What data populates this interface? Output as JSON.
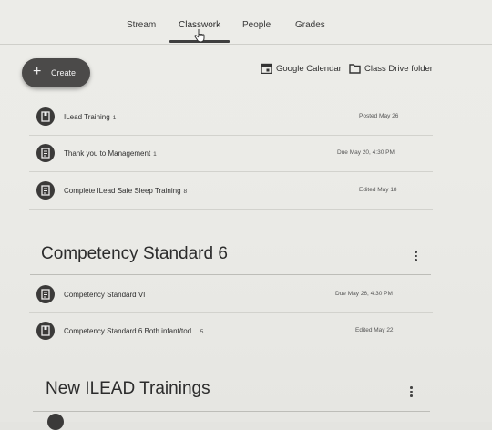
{
  "tabs": [
    {
      "label": "Stream"
    },
    {
      "label": "Classwork"
    },
    {
      "label": "People"
    },
    {
      "label": "Grades"
    }
  ],
  "toolbar": {
    "create_label": "Create",
    "calendar_label": "Google Calendar",
    "drive_label": "Class Drive folder"
  },
  "items": [
    {
      "title": "ILead Training",
      "count": "1",
      "meta": "Posted May 26",
      "icon": "material-icon"
    },
    {
      "title": "Thank you to Management",
      "count": "1",
      "meta": "Due May 20, 4:30 PM",
      "icon": "assignment-icon"
    },
    {
      "title": "Complete ILead Safe Sleep Training",
      "count": "8",
      "meta": "Edited May 18",
      "icon": "assignment-icon"
    }
  ],
  "sections": [
    {
      "title": "Competency Standard 6",
      "items": [
        {
          "title": "Competency Standard VI",
          "count": "",
          "meta": "Due May 26, 4:30 PM",
          "icon": "assignment-icon"
        },
        {
          "title": "Competency Standard 6 Both infant/tod...",
          "count": "5",
          "meta": "Edited May 22",
          "icon": "material-icon"
        }
      ]
    },
    {
      "title": "New ILEAD Trainings",
      "items": []
    }
  ],
  "colors": {
    "background": "#ebebe7",
    "icon_dark": "#3b3a39",
    "create_button": "#4b4a49"
  }
}
